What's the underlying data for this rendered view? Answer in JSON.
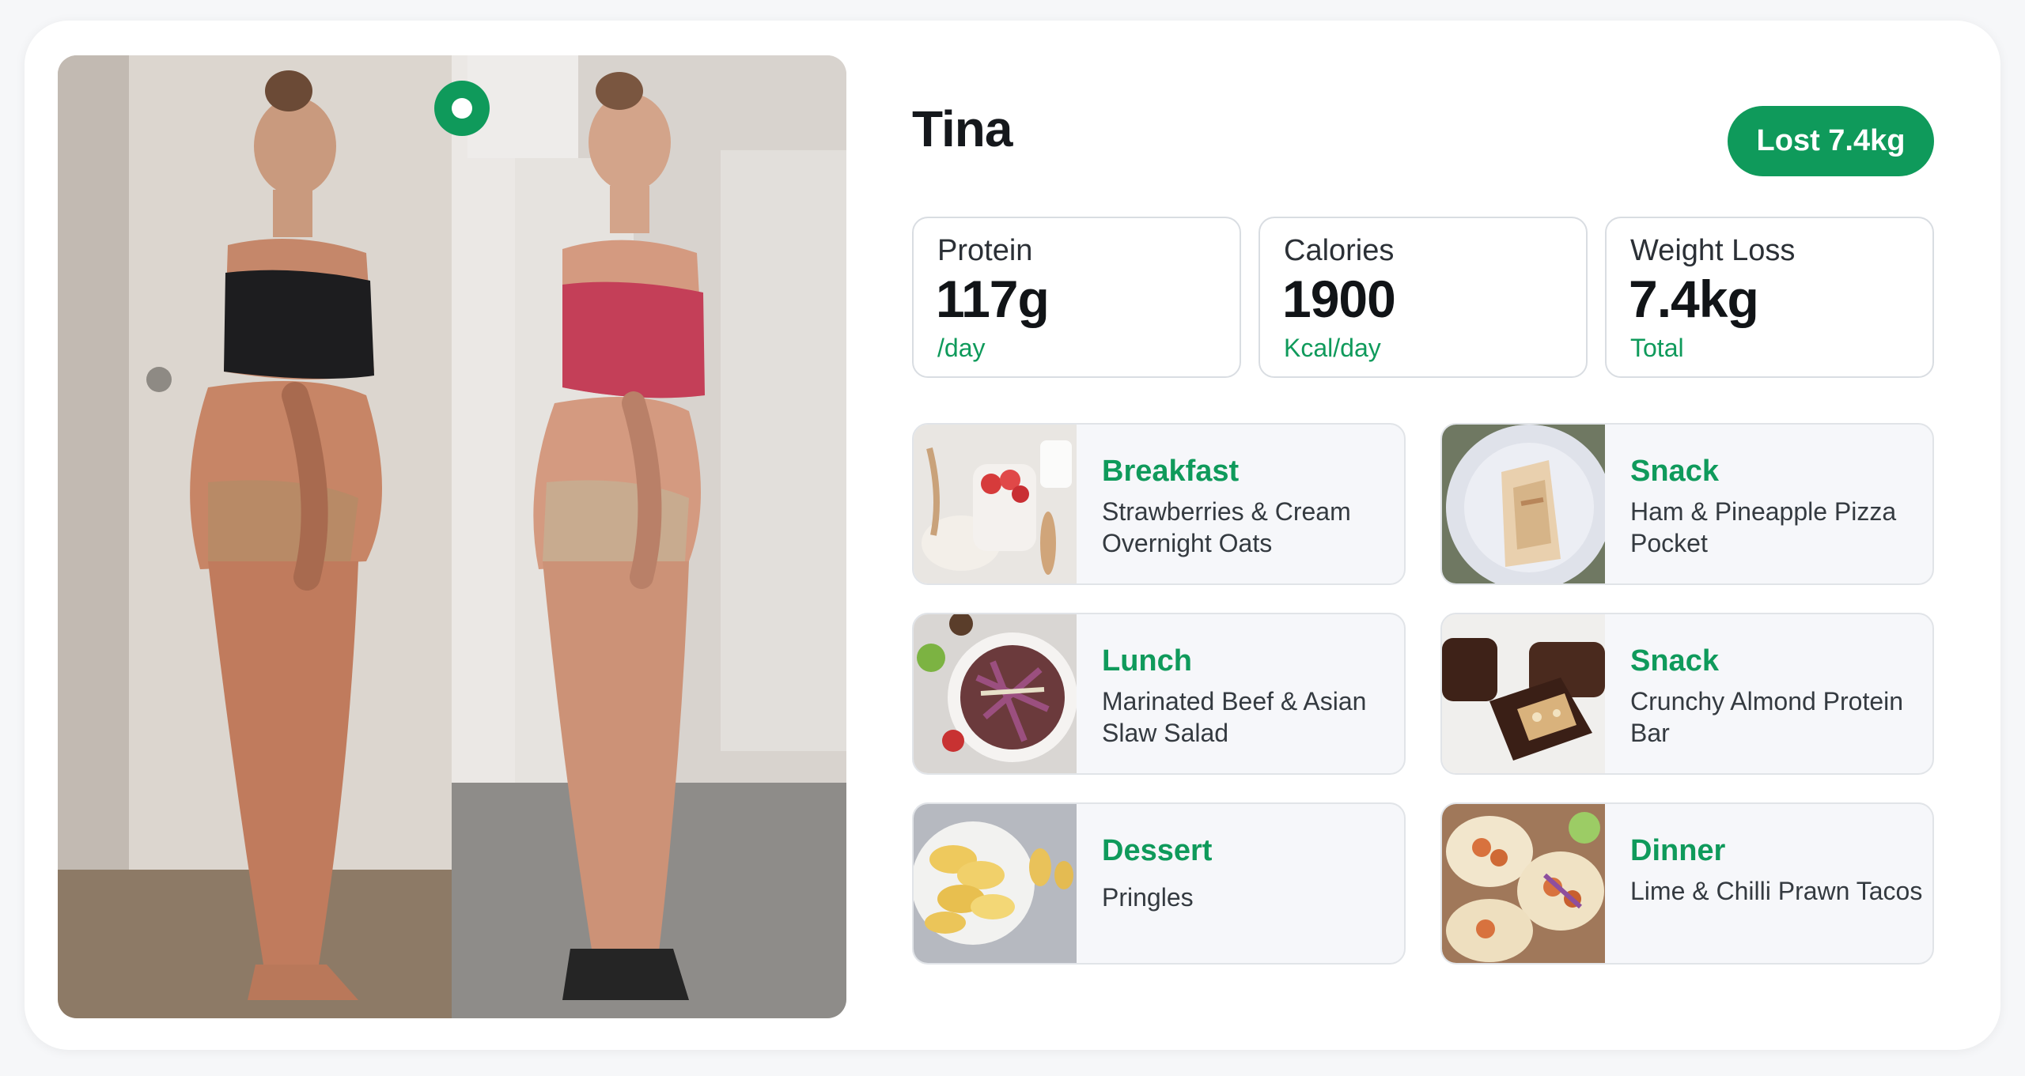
{
  "profile": {
    "name": "Tina",
    "badge": "Lost 7.4kg"
  },
  "stats": [
    {
      "label": "Protein",
      "value": "117g",
      "unit": "/day"
    },
    {
      "label": "Calories",
      "value": "1900",
      "unit": "Kcal/day"
    },
    {
      "label": "Weight Loss",
      "value": "7.4kg",
      "unit": "Total"
    }
  ],
  "meals": [
    {
      "type": "Breakfast",
      "name": "Strawberries & Cream Overnight Oats"
    },
    {
      "type": "Snack",
      "name": "Ham & Pineapple Pizza Pocket"
    },
    {
      "type": "Lunch",
      "name": "Marinated Beef & Asian Slaw Salad"
    },
    {
      "type": "Snack",
      "name": "Crunchy Almond Protein Bar"
    },
    {
      "type": "Dessert",
      "name": "Pringles"
    },
    {
      "type": "Dinner",
      "name": "Lime & Chilli Prawn Tacos"
    }
  ],
  "colors": {
    "accent": "#0f9a5b",
    "card_border": "#d9dde2",
    "meal_bg": "#f6f7fa"
  }
}
